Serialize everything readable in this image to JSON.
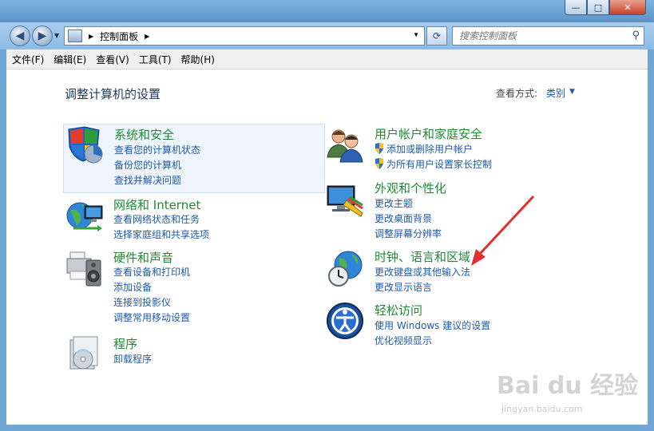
{
  "window": {
    "min_label": "—",
    "max_label": "□",
    "close_label": "✕"
  },
  "nav": {
    "back_label": "◀",
    "forward_label": "▶",
    "address": "控制面板",
    "search_placeholder": "搜索控制面板"
  },
  "menu": [
    "文件(F)",
    "编辑(E)",
    "查看(V)",
    "工具(T)",
    "帮助(H)"
  ],
  "main": {
    "title": "调整计算机的设置",
    "view_by_label": "查看方式:",
    "view_by_value": "类别"
  },
  "categories": [
    {
      "title": "系统和安全",
      "icon": "shield-pc-icon",
      "links": [
        "查看您的计算机状态",
        "备份您的计算机",
        "查找并解决问题"
      ]
    },
    {
      "title": "网络和 Internet",
      "icon": "network-globe-icon",
      "links": [
        "查看网络状态和任务",
        "选择家庭组和共享选项"
      ]
    },
    {
      "title": "硬件和声音",
      "icon": "printer-speaker-icon",
      "links": [
        "查看设备和打印机",
        "添加设备",
        "连接到投影仪",
        "调整常用移动设置"
      ]
    },
    {
      "title": "程序",
      "icon": "programs-icon",
      "links": [
        "卸载程序"
      ]
    },
    {
      "title": "用户帐户和家庭安全",
      "icon": "users-icon",
      "links": [
        "添加或删除用户帐户",
        "为所有用户设置家长控制"
      ]
    },
    {
      "title": "外观和个性化",
      "icon": "monitor-palette-icon",
      "links": [
        "更改主题",
        "更改桌面背景",
        "调整屏幕分辨率"
      ]
    },
    {
      "title": "时钟、语言和区域",
      "icon": "clock-globe-icon",
      "links": [
        "更改键盘或其他输入法",
        "更改显示语言"
      ]
    },
    {
      "title": "轻松访问",
      "icon": "ease-of-access-icon",
      "links": [
        "使用 Windows 建议的设置",
        "优化视频显示"
      ]
    }
  ],
  "watermark": {
    "text": "Bai du 经验",
    "url": "jingyan.baidu.com"
  },
  "colors": {
    "category_title": "#1e8a34",
    "link": "#1e5aa8",
    "annotation_arrow": "#e23030"
  }
}
